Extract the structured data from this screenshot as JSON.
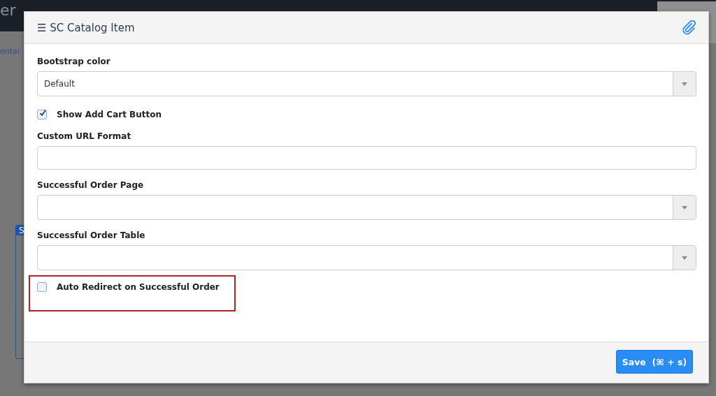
{
  "background": {
    "nav_label": "er",
    "side_link": "ontai",
    "panel_tab": "S"
  },
  "modal": {
    "title": "SC Catalog Item",
    "menu_glyph": "☰",
    "fields": [
      {
        "kind": "select",
        "label": "Bootstrap color",
        "value": "Default"
      },
      {
        "kind": "checkbox",
        "label": "Show Add Cart Button",
        "checked": true,
        "highlighted": false
      },
      {
        "kind": "text",
        "label": "Custom URL Format"
      },
      {
        "kind": "select",
        "label": "Successful Order Page"
      },
      {
        "kind": "select",
        "label": "Successful Order Table"
      },
      {
        "kind": "checkbox",
        "label": "Auto Redirect on Successful Order",
        "checked": false,
        "highlighted": true
      }
    ],
    "save_button": "Save  (⌘ + s)"
  }
}
